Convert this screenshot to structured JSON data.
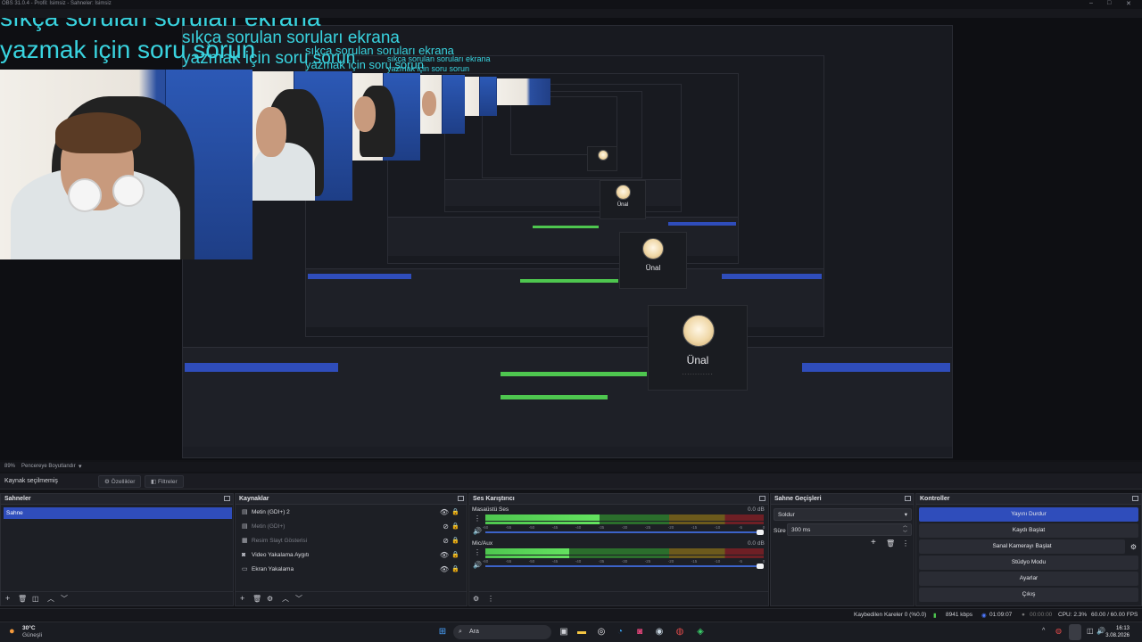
{
  "window": {
    "title": "OBS 31.0.4 - Profil: İsimsiz - Sahneler: İsimsiz"
  },
  "overlay": {
    "text1": "sıkça sorulan soruları ekrana",
    "text2": "yazmak  için soru sorun"
  },
  "popup": {
    "name": "Ünal",
    "dots": "............"
  },
  "scene_bar": {
    "zoom": "89%",
    "fit_label": "Pencereye Boyutlandır"
  },
  "source_toolbar": {
    "no_source": "Kaynak seçilmemiş",
    "properties": "Özellikler",
    "filters": "Filtreler"
  },
  "scenes": {
    "title": "Sahneler",
    "items": [
      "Sahne"
    ]
  },
  "sources": {
    "title": "Kaynaklar",
    "items": [
      "Metin (GDI+) 2",
      "Metin (GDI+)",
      "Resim Slayt Gösterisi",
      "Video Yakalama Aygıtı",
      "Ekran Yakalama"
    ]
  },
  "mixer": {
    "title": "Ses Karıştırıcı",
    "channels": [
      {
        "name": "Masaüstü Ses",
        "db": "0.0 dB",
        "level": 0.41
      },
      {
        "name": "Mic/Aux",
        "db": "0.0 dB",
        "level": 0.3
      }
    ],
    "ticks": [
      "-60",
      "-55",
      "-50",
      "-45",
      "-40",
      "-35",
      "-30",
      "-25",
      "-20",
      "-15",
      "-10",
      "-5",
      "0"
    ]
  },
  "transitions": {
    "title": "Sahne Geçişleri",
    "selected": "Soldur",
    "duration_label": "Süre",
    "duration": "300 ms"
  },
  "controls": {
    "title": "Kontroller",
    "buttons": [
      "Yayını Durdur",
      "Kaydı Başlat",
      "Sanal Kamerayı Başlat",
      "Stüdyo Modu",
      "Ayarlar",
      "Çıkış"
    ]
  },
  "status": {
    "dropped": "Kaybedilen Kareler 0 (%0.0)",
    "bitrate": "8941 kbps",
    "stream_time": "01:09:07",
    "rec_time": "00:00:00",
    "cpu": "CPU: 2.3%",
    "fps": "60.00 / 60.00 FPS"
  },
  "taskbar": {
    "weather_temp": "30°C",
    "weather_desc": "Güneşli",
    "search": "Ara",
    "time": "16:13",
    "date": "3.08.2026"
  },
  "colors": {
    "accent": "#2f4dbb",
    "overlay_text": "#39d3df",
    "meter_green": "#4ec64f"
  }
}
